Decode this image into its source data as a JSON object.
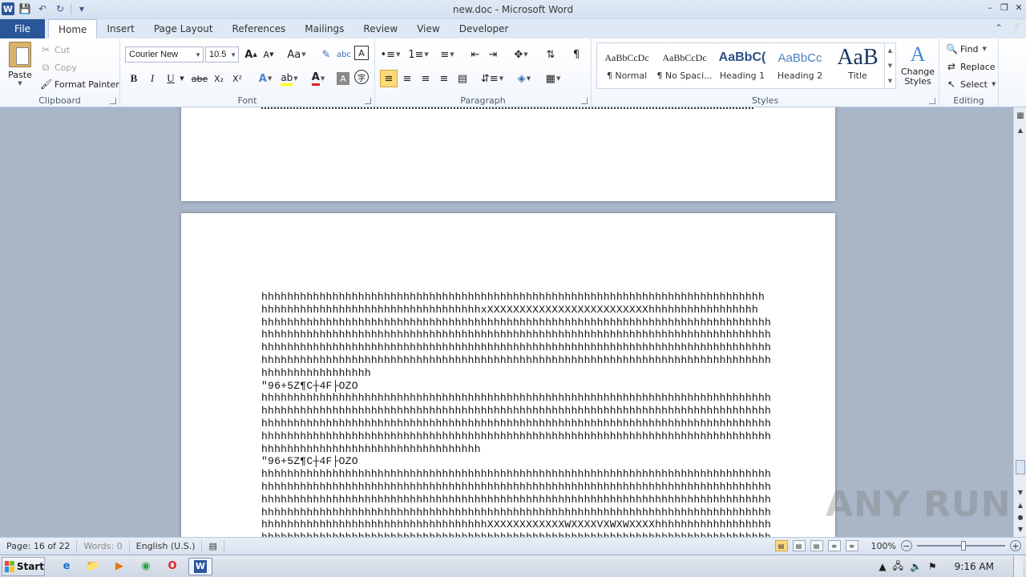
{
  "window": {
    "title": "new.doc - Microsoft Word",
    "app_icon": "W"
  },
  "ribbon_tabs": [
    "File",
    "Home",
    "Insert",
    "Page Layout",
    "References",
    "Mailings",
    "Review",
    "View",
    "Developer"
  ],
  "active_tab": "Home",
  "clipboard": {
    "paste": "Paste",
    "cut": "Cut",
    "copy": "Copy",
    "format_painter": "Format Painter",
    "label": "Clipboard"
  },
  "font": {
    "name": "Courier New",
    "size": "10.5",
    "label": "Font",
    "bold": "B",
    "italic": "I",
    "underline": "U",
    "strike": "abe",
    "subscript": "X₂",
    "superscript": "X²"
  },
  "paragraph": {
    "label": "Paragraph"
  },
  "styles": {
    "label": "Styles",
    "items": [
      {
        "sample": "AaBbCcDc",
        "name": "¶ Normal"
      },
      {
        "sample": "AaBbCcDc",
        "name": "¶ No Spaci..."
      },
      {
        "sample": "AaBbC(",
        "name": "Heading 1"
      },
      {
        "sample": "AaBbCc",
        "name": "Heading 2"
      },
      {
        "sample": "AaB",
        "name": "Title"
      }
    ],
    "change_styles": "Change Styles"
  },
  "editing": {
    "label": "Editing",
    "find": "Find",
    "replace": "Replace",
    "select": "Select"
  },
  "document": {
    "lines": [
      "hhhhhhhhhhhhhhhhhhhhhhhhhhhhhhhhhhhhhhhhhhhhhhhhhhhhhhhhhhhhhhhhhhhhhhhhhhhhhh",
      "hhhhhhhhhhhhhhhhhhhhhhhhhhhhhhhhhhxXXXXXXXXXXXXXXXXXXXXXXXXXhhhhhhhhhhhhhhhhh",
      "hhhhhhhhhhhhhhhhhhhhhhhhhhhhhhhhhhhhhhhhhhhhhhhhhhhhhhhhhhhhhhhhhhhhhhhhhhhhhhh",
      "hhhhhhhhhhhhhhhhhhhhhhhhhhhhhhhhhhhhhhhhhhhhhhhhhhhhhhhhhhhhhhhhhhhhhhhhhhhhhhh",
      "hhhhhhhhhhhhhhhhhhhhhhhhhhhhhhhhhhhhhhhhhhhhhhhhhhhhhhhhhhhhhhhhhhhhhhhhhhhhhhh",
      "hhhhhhhhhhhhhhhhhhhhhhhhhhhhhhhhhhhhhhhhhhhhhhhhhhhhhhhhhhhhhhhhhhhhhhhhhhhhhhh",
      "hhhhhhhhhhhhhhhhh",
      "\"96+5Z¶C┼4F├OZO",
      "hhhhhhhhhhhhhhhhhhhhhhhhhhhhhhhhhhhhhhhhhhhhhhhhhhhhhhhhhhhhhhhhhhhhhhhhhhhhhhh",
      "hhhhhhhhhhhhhhhhhhhhhhhhhhhhhhhhhhhhhhhhhhhhhhhhhhhhhhhhhhhhhhhhhhhhhhhhhhhhhhh",
      "hhhhhhhhhhhhhhhhhhhhhhhhhhhhhhhhhhhhhhhhhhhhhhhhhhhhhhhhhhhhhhhhhhhhhhhhhhhhhhh",
      "hhhhhhhhhhhhhhhhhhhhhhhhhhhhhhhhhhhhhhhhhhhhhhhhhhhhhhhhhhhhhhhhhhhhhhhhhhhhhhh",
      "hhhhhhhhhhhhhhhhhhhhhhhhhhhhhhhhhh",
      "\"96+5Z¶C┼4F├OZO",
      "hhhhhhhhhhhhhhhhhhhhhhhhhhhhhhhhhhhhhhhhhhhhhhhhhhhhhhhhhhhhhhhhhhhhhhhhhhhhhhh",
      "hhhhhhhhhhhhhhhhhhhhhhhhhhhhhhhhhhhhhhhhhhhhhhhhhhhhhhhhhhhhhhhhhhhhhhhhhhhhhhh",
      "hhhhhhhhhhhhhhhhhhhhhhhhhhhhhhhhhhhhhhhhhhhhhhhhhhhhhhhhhhhhhhhhhhhhhhhhhhhhhhh",
      "hhhhhhhhhhhhhhhhhhhhhhhhhhhhhhhhhhhhhhhhhhhhhhhhhhhhhhhhhhhhhhhhhhhhhhhhhhhhhhh",
      "hhhhhhhhhhhhhhhhhhhhhhhhhhhhhhhhhhhXXXXXXXXXXXXWXXXXVXWXWXXXXhhhhhhhhhhhhhhhhhh",
      "hhhhhhhhhhhhhhhhhhhhhhhhhhhhhhhhhhhhhhhhhhhhhhhhhhhhhhhhhhhhhhhhhhhhhhhhhhhhhhh"
    ]
  },
  "statusbar": {
    "page": "Page: 16 of 22",
    "words": "Words: 0",
    "language": "English (U.S.)",
    "zoom": "100%",
    "zoom_level": 1.0
  },
  "watermark": "ANY RUN",
  "taskbar": {
    "start": "Start",
    "clock": "9:16 AM"
  }
}
